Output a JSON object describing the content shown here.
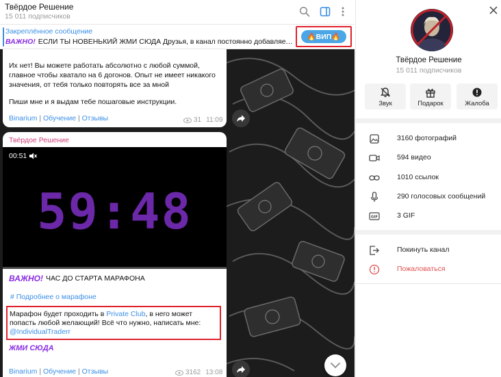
{
  "header": {
    "title": "Твёрдое Решение",
    "subtitle": "15 011 подписчиков"
  },
  "pinned": {
    "label": "Закреплённое сообщение",
    "badge": "ВАЖНО!",
    "text": "ЕСЛИ ТЫ НОВЕНЬКИЙ ЖМИ СЮДА  Друзья, в канал постоянно добавляется много новых людей",
    "vip_button": "🔥ВИП🔥"
  },
  "message1": {
    "paragraph1": "Их нет! Вы можете работать абсолютно с любой суммой, главное чтобы хватало на 6 догонов. Опыт не имеет никакого значения, от тебя только повторять все за мной",
    "paragraph2": "Пиши мне и я выдам тебе пошаговые инструкции.",
    "links": [
      "Binarium",
      "Обучение",
      "Отзывы"
    ],
    "separator": "|",
    "views": "31",
    "time": "11:09"
  },
  "message2": {
    "author": "Твёрдое Решение",
    "video": {
      "duration": "00:51",
      "timer": "59:48",
      "progress": 0.0
    },
    "badge": "ВАЖНО!",
    "heading": "ЧАС ДО СТАРТА МАРАФОНА",
    "tag": "# Подробнее о марафоне",
    "body_part1": "Марафон будет проходить в ",
    "body_link": "Private Club",
    "body_part2": ", в него может попасть любой желающий! Всё что нужно, написать мне: ",
    "body_handle": "@IndividualTraderr",
    "sticker": "ЖМИ СЮДА",
    "links": [
      "Binarium",
      "Обучение",
      "Отзывы"
    ],
    "separator": "|",
    "views": "3162",
    "time": "13:08"
  },
  "info_panel": {
    "title": "Твёрдое Решение",
    "subtitle": "15 011 подписчиков",
    "actions": [
      {
        "label": "Звук",
        "icon": "bell-muted-icon"
      },
      {
        "label": "Подарок",
        "icon": "gift-icon"
      },
      {
        "label": "Жалоба",
        "icon": "report-icon"
      }
    ],
    "media": [
      {
        "label": "3160 фотографий",
        "icon": "photo-icon"
      },
      {
        "label": "594 видео",
        "icon": "video-icon"
      },
      {
        "label": "1010 ссылок",
        "icon": "link-icon"
      },
      {
        "label": "290 голосовых сообщений",
        "icon": "microphone-icon"
      },
      {
        "label": "3 GIF",
        "icon": "gif-icon"
      }
    ],
    "leave": "Покинуть канал",
    "report": "Пожаловаться"
  },
  "colors": {
    "accent": "#3a8ee6",
    "highlight_border": "#e0202a",
    "timer_purple": "#6b28a8",
    "author_pink": "#d0407a",
    "danger": "#e05050"
  }
}
